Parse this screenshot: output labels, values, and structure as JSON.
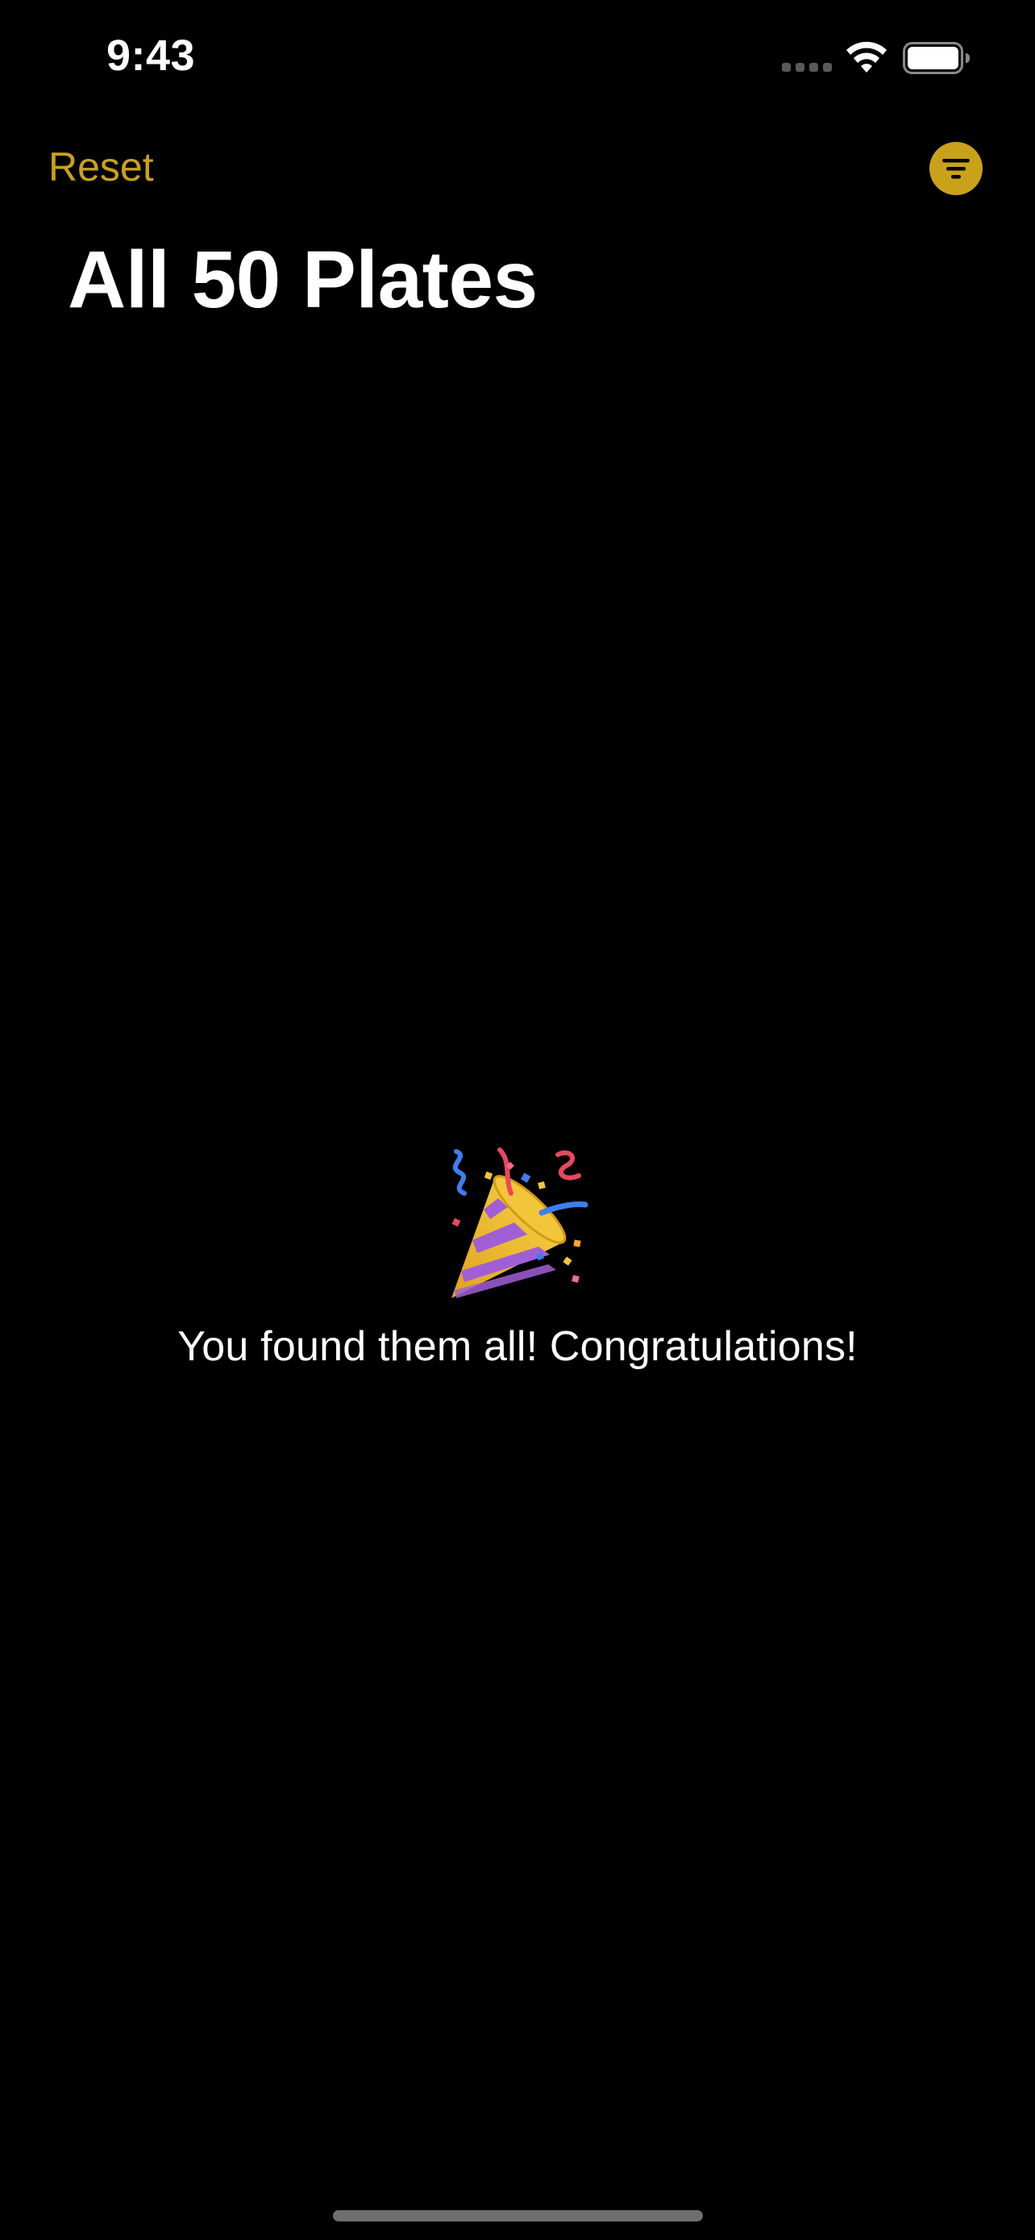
{
  "status_bar": {
    "time": "9:43"
  },
  "nav": {
    "reset_label": "Reset",
    "filter_icon": "filter-circle-icon"
  },
  "page": {
    "title": "All 50 Plates"
  },
  "empty_state": {
    "icon": "party-popper-icon",
    "message": "You found them all! Congratulations!"
  },
  "colors": {
    "accent": "#c9a21a",
    "background": "#000000",
    "text": "#ffffff"
  }
}
